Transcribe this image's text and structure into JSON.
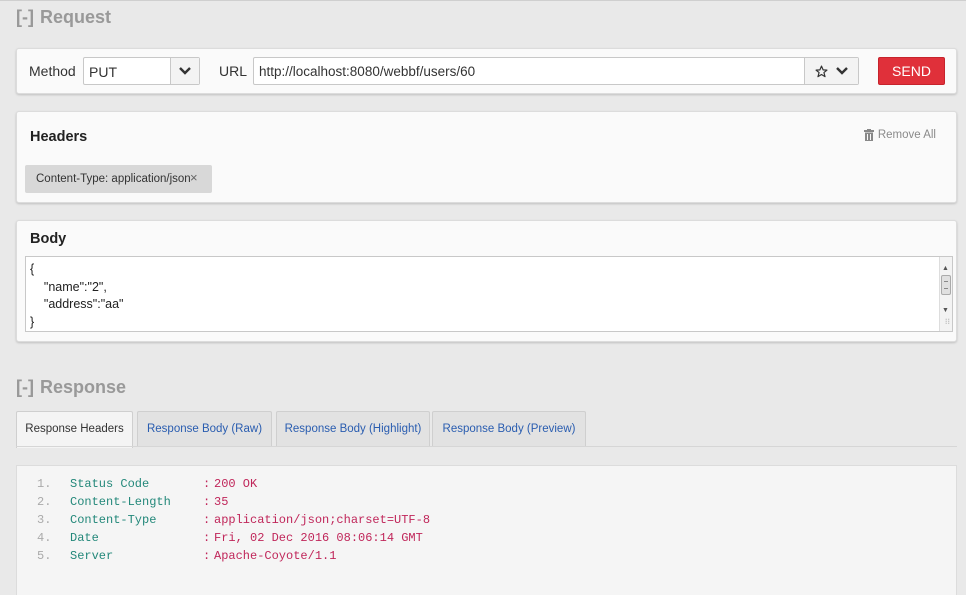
{
  "request": {
    "section_toggle": "[-]",
    "section_title": "Request",
    "method_label": "Method",
    "method_value": "PUT",
    "url_label": "URL",
    "url_value": "http://localhost:8080/webbf/users/60",
    "send_label": "SEND",
    "icons": {
      "bookmark": "star-icon",
      "url_options": "chevron-down-icon",
      "method_caret": "chevron-down-icon"
    }
  },
  "headers": {
    "title": "Headers",
    "remove_all_label": "Remove All",
    "remove_all_icon": "trash-icon",
    "items": [
      {
        "label": "Content-Type: application/json",
        "remove_glyph": "×"
      }
    ]
  },
  "body": {
    "title": "Body",
    "lines": [
      "{",
      "    \"name\":\"2\",",
      "    \"address\":\"aa\"",
      "}"
    ]
  },
  "response": {
    "section_toggle": "[-]",
    "section_title": "Response",
    "tabs": [
      {
        "label": "Response Headers",
        "active": true
      },
      {
        "label": "Response Body (Raw)",
        "active": false
      },
      {
        "label": "Response Body (Highlight)",
        "active": false
      },
      {
        "label": "Response Body (Preview)",
        "active": false
      }
    ],
    "headers": [
      {
        "num": "1.",
        "key": "Status Code",
        "colon": ":",
        "value": "200 OK"
      },
      {
        "num": "2.",
        "key": "Content-Length",
        "colon": ":",
        "value": "35"
      },
      {
        "num": "3.",
        "key": "Content-Type",
        "colon": ":",
        "value": "application/json;charset=UTF-8"
      },
      {
        "num": "4.",
        "key": "Date",
        "colon": ":",
        "value": "Fri, 02 Dec 2016 08:06:14 GMT"
      },
      {
        "num": "5.",
        "key": "Server",
        "colon": ":",
        "value": "Apache-Coyote/1.1"
      }
    ]
  },
  "colors": {
    "send_button": "#e0303a",
    "tab_link": "#2a5db0",
    "response_key": "#23887a",
    "response_value": "#c0265a"
  }
}
